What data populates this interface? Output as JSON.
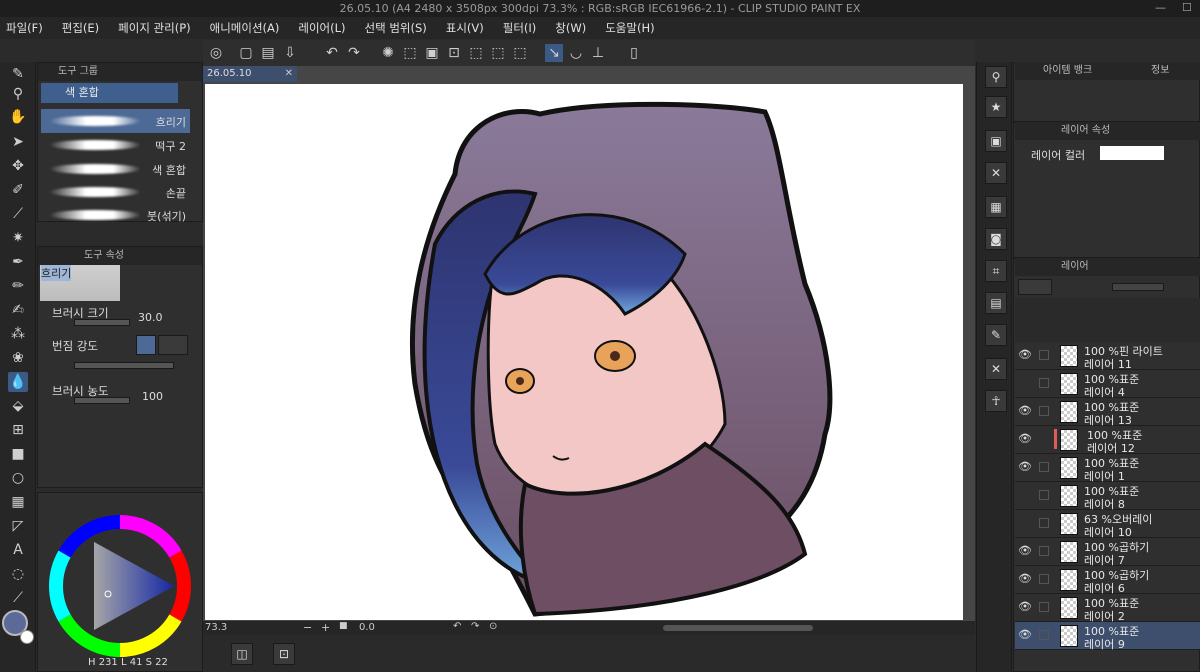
{
  "window": {
    "title": "26.05.10 (A4 2480 x 3508px 300dpi 73.3% : RGB:sRGB IEC61966-2.1) - CLIP STUDIO PAINT EX",
    "controls": [
      "—",
      "☐"
    ]
  },
  "menu": [
    "파일(F)",
    "편집(E)",
    "페이지 관리(P)",
    "애니메이션(A)",
    "레이어(L)",
    "선택 범위(S)",
    "표시(V)",
    "필터(I)",
    "창(W)",
    "도움말(H)"
  ],
  "subtool_panel": {
    "tab": "도구 그룹",
    "selected_group": "색 혼합",
    "brushes": [
      {
        "label": "흐리기",
        "selected": true
      },
      {
        "label": "떡구 2",
        "selected": false
      },
      {
        "label": "색 혼합",
        "selected": false
      },
      {
        "label": "손끝",
        "selected": false
      },
      {
        "label": "붓(섞기)",
        "selected": false
      }
    ]
  },
  "tool_property": {
    "tab": "도구 속성",
    "preview_label": "흐리기",
    "brush_size_label": "브러시 크기",
    "brush_size_value": "30.0",
    "blend_label": "번짐 강도",
    "density_label": "브러시 농도",
    "density_value": "100"
  },
  "color": {
    "main_color": "#5b6a98",
    "sub_color": "#ffffff",
    "hsv_text": "H 231  L 41  S 22"
  },
  "document": {
    "tab_label": "26.05.10",
    "zoom": "73.3",
    "angle": "0.0"
  },
  "right_panel": {
    "item_bank_tab": "아이템 뱅크",
    "info_tab": "정보",
    "layer_property_tab": "레이어 속성",
    "layer_color_label": "레이어 컬러",
    "layer_tab": "레이어"
  },
  "layers": [
    {
      "mode": "100 %핀 라이트",
      "name": "레이어 11",
      "visible": true
    },
    {
      "mode": "100 %표준",
      "name": "레이어 4",
      "visible": false
    },
    {
      "mode": "100 %표준",
      "name": "레이어 13",
      "visible": true
    },
    {
      "mode": "100 %표준",
      "name": "레이어 12",
      "visible": true
    },
    {
      "mode": "100 %표준",
      "name": "레이어 1",
      "visible": true
    },
    {
      "mode": "100 %표준",
      "name": "레이어 8",
      "visible": false
    },
    {
      "mode": "63 %오버레이",
      "name": "레이어 10",
      "visible": false
    },
    {
      "mode": "100 %곱하기",
      "name": "레이어 7",
      "visible": true
    },
    {
      "mode": "100 %곱하기",
      "name": "레이어 6",
      "visible": true
    },
    {
      "mode": "100 %표준",
      "name": "레이어 2",
      "visible": true
    },
    {
      "mode": "100 %표준",
      "name": "레이어 9",
      "visible": true
    }
  ]
}
